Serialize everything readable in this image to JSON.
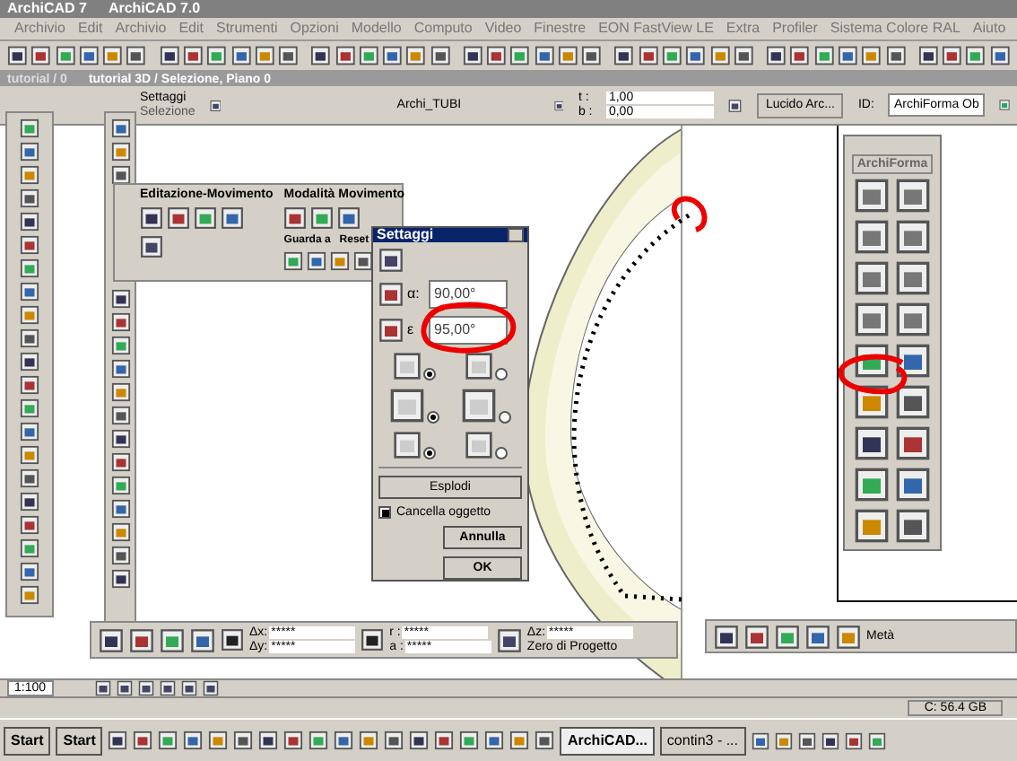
{
  "title_bar": {
    "titles": [
      "ArchiCAD 7",
      "ArchiCAD 7.0"
    ]
  },
  "menu_bar": {
    "items": [
      "Archivio",
      "Edit",
      "Archivio",
      "Edit",
      "Strumenti",
      "Opzioni",
      "Modello",
      "Computo",
      "Video",
      "Finestre",
      "EON FastView LE",
      "Extra",
      "Profiler",
      "Sistema Colore RAL",
      "Aiuto"
    ]
  },
  "window_tabs": [
    {
      "label": "tutorial / 0",
      "selected": false
    },
    {
      "label": "tutorial 3D / Selezione, Piano 0",
      "selected": true
    }
  ],
  "info_box": {
    "settings_label": "Settaggi",
    "selection_label": "Selezione",
    "layer_name": "Archi_TUBI",
    "t_label": "t :",
    "t_value": "1,00",
    "b_label": "b :",
    "b_value": "0,00",
    "layer_button": "Lucido Arc...",
    "id_label": "ID:",
    "id_value": "ArchiForma Ob"
  },
  "edit_palette": {
    "title": "Editazione-Movimento",
    "mode_title": "Modalità Movimento",
    "look_label": "Guarda a",
    "reset_label": "Reset"
  },
  "settings_dialog": {
    "title": "Settaggi",
    "fields": [
      {
        "label": "α:",
        "value": "90,00°"
      },
      {
        "label": "ε",
        "value": "95,00°"
      }
    ],
    "radio_rows": [
      [
        {
          "selected": true
        },
        {
          "selected": false
        }
      ],
      [
        {
          "selected": true
        },
        {
          "selected": false
        }
      ],
      [
        {
          "selected": true
        },
        {
          "selected": false
        }
      ]
    ],
    "explode_button": "Esplodi",
    "delete_object": {
      "label": "Cancella oggetto",
      "checked": true
    },
    "buttons": [
      "Annulla",
      "OK"
    ]
  },
  "archiforma_palette": {
    "title": "ArchiForma"
  },
  "coordinates_palette": {
    "fields": [
      {
        "label": "Δx:",
        "value": "*****"
      },
      {
        "label": "Δy:",
        "value": "*****"
      },
      {
        "label": "r :",
        "value": "*****"
      },
      {
        "label": "a :",
        "value": "*****"
      },
      {
        "label": "Δz:",
        "value": "*****"
      }
    ],
    "origin_button": "Zero di Progetto"
  },
  "line_palette": {
    "label": "Metà"
  },
  "scale": "1:100",
  "status_bar": {
    "disk": "C: 56.4 GB"
  },
  "taskbar": {
    "start_buttons": [
      "Start",
      "Start"
    ],
    "tasks": [
      {
        "label": "ArchiCAD...",
        "selected": true
      },
      {
        "label": "contin3 - ...",
        "selected": false
      }
    ]
  }
}
